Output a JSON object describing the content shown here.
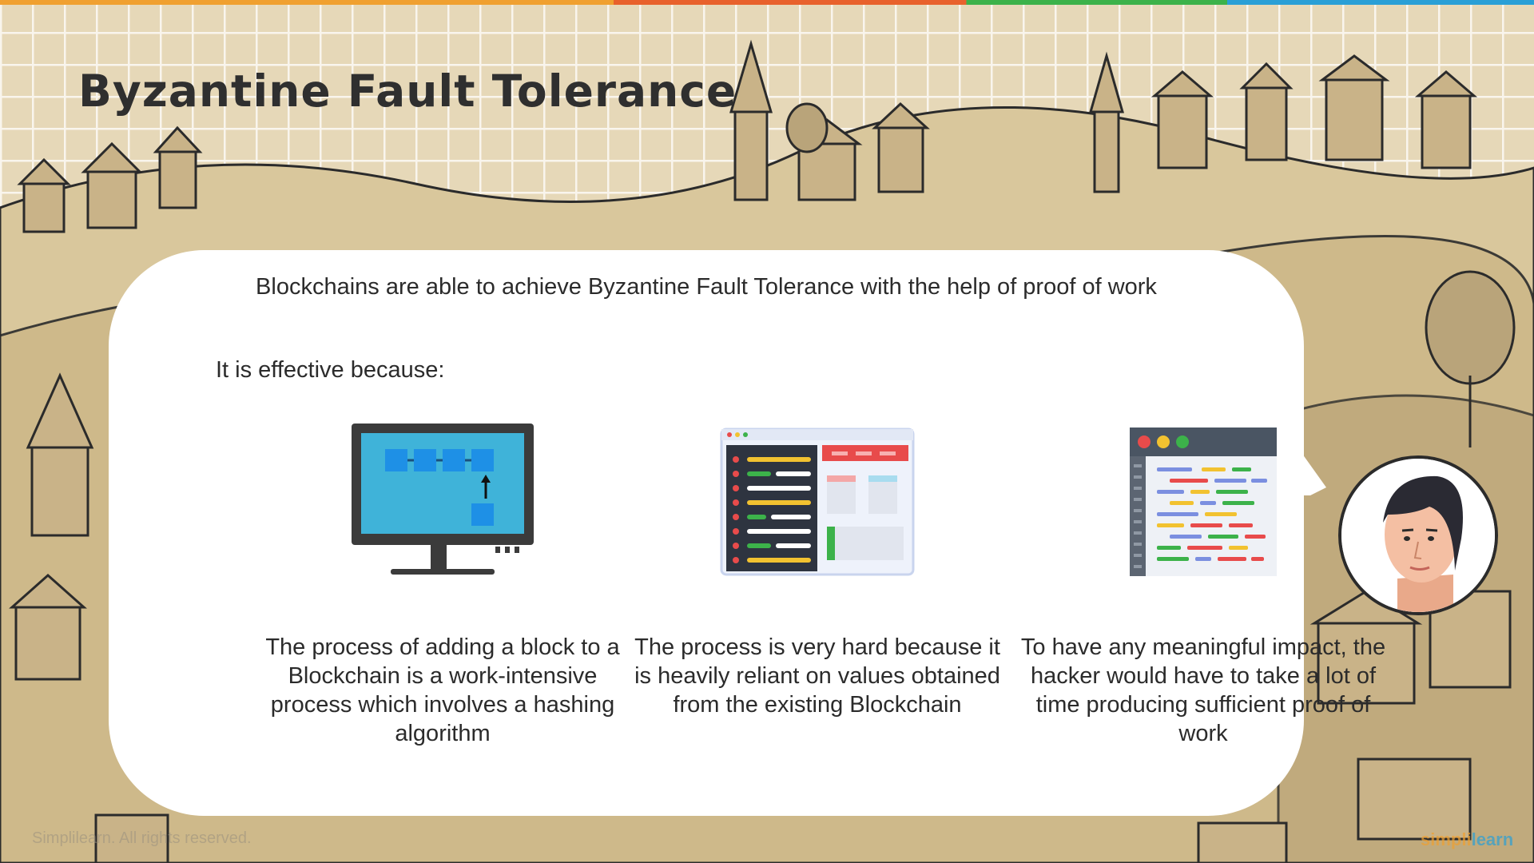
{
  "title": "Byzantine Fault Tolerance",
  "bubble": {
    "intro": "Blockchains are able to achieve Byzantine Fault Tolerance with the help of proof of work",
    "lead": "It is effective because:",
    "points": [
      {
        "icon": "computer-blockchain-icon",
        "text": "The process of adding a block to a Blockchain is a work-intensive process which involves a hashing algorithm"
      },
      {
        "icon": "dashboard-window-icon",
        "text": "The process is very hard because it is heavily reliant on values obtained from the existing Blockchain"
      },
      {
        "icon": "code-editor-icon",
        "text": "To have any meaningful impact, the hacker would have to take a lot of time producing sufficient proof of work"
      }
    ]
  },
  "presenter": {
    "icon": "presenter-avatar-icon"
  },
  "footer": {
    "copyright": "Simplilearn. All rights reserved."
  },
  "logo": {
    "part1": "simpli",
    "part2": "learn"
  },
  "colors": {
    "title": "#2f2f2f",
    "bubble": "#ffffff",
    "screen": "#3fb3d9",
    "block": "#1e90e6"
  }
}
